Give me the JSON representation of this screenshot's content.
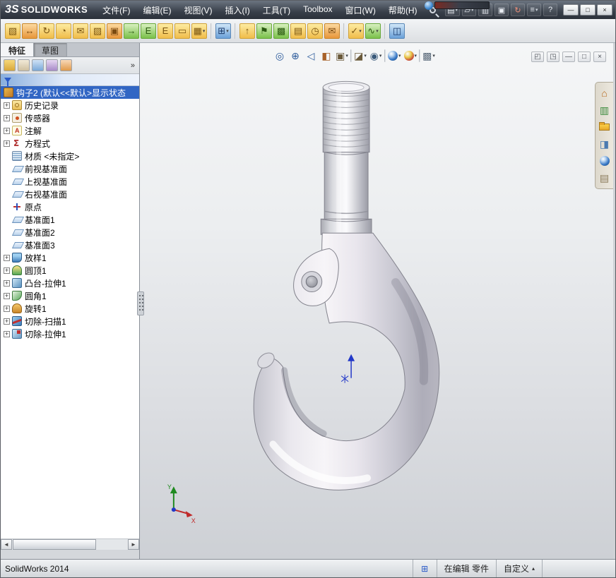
{
  "ui": {
    "dropdown_arrow": "▾",
    "plus": "+",
    "arrow_left": "◄",
    "arrow_right": "►",
    "up_arrow": "▴"
  },
  "titlebar": {
    "logo_mark": "3S",
    "brand": "SOLIDWORKS",
    "menus": [
      {
        "name": "menu-file",
        "label": "文件(F)"
      },
      {
        "name": "menu-edit",
        "label": "编辑(E)"
      },
      {
        "name": "menu-view",
        "label": "视图(V)"
      },
      {
        "name": "menu-insert",
        "label": "插入(I)"
      },
      {
        "name": "menu-tools",
        "label": "工具(T)"
      },
      {
        "name": "menu-toolbox",
        "label": "Toolbox"
      },
      {
        "name": "menu-window",
        "label": "窗口(W)"
      },
      {
        "name": "menu-help",
        "label": "帮助(H)"
      }
    ],
    "quick_icons": [
      {
        "name": "new-document-icon",
        "glyph": "▤",
        "arrow": true
      },
      {
        "name": "open-document-icon",
        "glyph": "▱",
        "arrow": true
      },
      {
        "name": "save-icon",
        "glyph": "▥"
      },
      {
        "name": "print-icon",
        "glyph": "▣"
      },
      {
        "name": "rebuild-icon",
        "glyph": "↻",
        "color": "#f0907a"
      },
      {
        "name": "options-icon",
        "glyph": "≡",
        "arrow": true
      },
      {
        "name": "help-icon",
        "glyph": "?"
      }
    ],
    "window_buttons": [
      {
        "name": "minimize-button",
        "glyph": "—"
      },
      {
        "name": "maximize-button",
        "glyph": "□"
      },
      {
        "name": "close-button",
        "glyph": "×"
      }
    ]
  },
  "toolbar": {
    "icons": [
      {
        "name": "color-palette-icon",
        "glyph": "▧",
        "cls": "t-yellow"
      },
      {
        "name": "move-component-icon",
        "glyph": "↔",
        "cls": "t-orange"
      },
      {
        "name": "rotate-component-icon",
        "glyph": "↻",
        "cls": "t-yellow"
      },
      {
        "name": "alert-icon",
        "glyph": "◔",
        "cls": "t-yellow"
      },
      {
        "name": "envelope-icon",
        "glyph": "✉",
        "cls": "t-yellow"
      },
      {
        "name": "edit-sketch-icon",
        "glyph": "▨",
        "cls": "t-yellow"
      },
      {
        "name": "stamp-icon",
        "glyph": "▣",
        "cls": "t-orange"
      },
      {
        "name": "export-arrow-icon",
        "glyph": "→",
        "cls": "t-green"
      },
      {
        "name": "edrawings-icon",
        "glyph": "E",
        "cls": "t-green"
      },
      {
        "name": "equation-icon",
        "glyph": "E",
        "cls": "t-yellow"
      },
      {
        "name": "ruler-icon",
        "glyph": "▭",
        "cls": "t-yellow"
      },
      {
        "name": "swatch-grid-icon",
        "glyph": "▦",
        "cls": "t-yellow",
        "arrow": true
      },
      {
        "cls": "sep"
      },
      {
        "name": "dot-grid-icon",
        "glyph": "⊞",
        "cls": "t-blue",
        "arrow": true
      },
      {
        "cls": "sep"
      },
      {
        "name": "publish-up-icon",
        "glyph": "↑",
        "cls": "t-yellow"
      },
      {
        "name": "flag-icon",
        "glyph": "⚑",
        "cls": "t-green"
      },
      {
        "name": "library-box-icon",
        "glyph": "▩",
        "cls": "t-green"
      },
      {
        "name": "folder-box-icon",
        "glyph": "▤",
        "cls": "t-yellow"
      },
      {
        "name": "clock-icon",
        "glyph": "◷",
        "cls": "t-yellow"
      },
      {
        "name": "mail-send-icon",
        "glyph": "✉",
        "cls": "t-orange"
      },
      {
        "cls": "sep"
      },
      {
        "name": "check-dropdown-icon",
        "glyph": "✓",
        "cls": "t-yellow",
        "arrow": true
      },
      {
        "name": "spring-icon",
        "glyph": "∿",
        "cls": "t-green",
        "arrow": true
      },
      {
        "cls": "sep"
      },
      {
        "name": "measure-toggle-icon",
        "glyph": "◫",
        "cls": "t-blue",
        "state": "active"
      }
    ]
  },
  "left_panel": {
    "tabs": [
      {
        "name": "tab-features",
        "label": "特征",
        "state": "active"
      },
      {
        "name": "tab-sketch",
        "label": "草图",
        "state": "inactive"
      }
    ],
    "pane_tabs": [
      {
        "name": "featuremanager-tab-icon",
        "cls": "pt-gold"
      },
      {
        "name": "propertymanager-tab-icon",
        "cls": "pt-beige"
      },
      {
        "name": "configurationmanager-tab-icon",
        "cls": "pt-blue"
      },
      {
        "name": "dimxpertmanager-tab-icon",
        "cls": "pt-violet"
      },
      {
        "name": "displaymanager-tab-icon",
        "cls": "pt-orange"
      }
    ],
    "overflow_chevron": "»",
    "tree": {
      "items": [
        {
          "name": "tree-item-part",
          "label": "钩子2 (默认<<默认>显示状态",
          "icon": "i-part",
          "state": "selected root"
        },
        {
          "name": "tree-item-history",
          "label": "历史记录",
          "icon": "i-history",
          "expand": true
        },
        {
          "name": "tree-item-sensors",
          "label": "传感器",
          "icon": "i-sensor",
          "expand": true
        },
        {
          "name": "tree-item-annotations",
          "label": "注解",
          "icon": "i-note",
          "expand": true
        },
        {
          "name": "tree-item-equations",
          "label": "方程式",
          "icon": "i-eq",
          "expand": true
        },
        {
          "name": "tree-item-material",
          "label": "材质 <未指定>",
          "icon": "i-mat"
        },
        {
          "name": "tree-item-front-plane",
          "label": "前视基准面",
          "icon": "i-plane"
        },
        {
          "name": "tree-item-top-plane",
          "label": "上视基准面",
          "icon": "i-plane"
        },
        {
          "name": "tree-item-right-plane",
          "label": "右视基准面",
          "icon": "i-plane"
        },
        {
          "name": "tree-item-origin",
          "label": "原点",
          "icon": "i-origin"
        },
        {
          "name": "tree-item-plane1",
          "label": "基准面1",
          "icon": "i-plane"
        },
        {
          "name": "tree-item-plane2",
          "label": "基准面2",
          "icon": "i-plane"
        },
        {
          "name": "tree-item-plane3",
          "label": "基准面3",
          "icon": "i-plane"
        },
        {
          "name": "tree-item-loft1",
          "label": "放样1",
          "icon": "i-loft",
          "expand": true
        },
        {
          "name": "tree-item-dome1",
          "label": "圆顶1",
          "icon": "i-dome",
          "expand": true
        },
        {
          "name": "tree-item-boss-extrude1",
          "label": "凸台-拉伸1",
          "icon": "i-boss",
          "expand": true
        },
        {
          "name": "tree-item-fillet1",
          "label": "圆角1",
          "icon": "i-fillet",
          "expand": true
        },
        {
          "name": "tree-item-revolve1",
          "label": "旋转1",
          "icon": "i-revolve",
          "expand": true
        },
        {
          "name": "tree-item-cut-sweep1",
          "label": "切除-扫描1",
          "icon": "i-sweepcut",
          "expand": true
        },
        {
          "name": "tree-item-cut-extrude1",
          "label": "切除-拉伸1",
          "icon": "i-cutextrude",
          "expand": true
        }
      ]
    }
  },
  "viewport": {
    "headsup": [
      {
        "name": "zoom-fit-icon",
        "glyph": "◎",
        "color": "#2a5a9a"
      },
      {
        "name": "zoom-area-icon",
        "glyph": "⊕",
        "color": "#2a5a9a"
      },
      {
        "name": "previous-view-icon",
        "glyph": "◁",
        "color": "#2a5a9a"
      },
      {
        "name": "section-view-icon",
        "glyph": "◧",
        "color": "#a8622a"
      },
      {
        "name": "view-orientation-icon",
        "glyph": "▣",
        "color": "#6a5a3a",
        "arrow": true
      },
      {
        "cls": "sep"
      },
      {
        "name": "display-style-icon",
        "glyph": "◪",
        "color": "#6a5a3a",
        "arrow": true
      },
      {
        "name": "hide-show-icon",
        "glyph": "◉",
        "color": "#3a5a7a",
        "arrow": true
      },
      {
        "cls": "sep"
      },
      {
        "name": "appearances-icon",
        "sphere": "sphere",
        "arrow": true
      },
      {
        "name": "scene-icon",
        "sphere": "sphere2",
        "arrow": true
      },
      {
        "cls": "sep"
      },
      {
        "name": "view-settings-icon",
        "glyph": "▩",
        "color": "#5a6a7a",
        "arrow": true
      }
    ],
    "doc_controls": [
      {
        "name": "pane-split-icon",
        "glyph": "◰"
      },
      {
        "name": "pane-full-icon",
        "glyph": "◳"
      },
      {
        "name": "doc-minimize-button",
        "glyph": "—"
      },
      {
        "name": "doc-restore-button",
        "glyph": "□"
      },
      {
        "name": "doc-close-button",
        "glyph": "×"
      }
    ],
    "task_pane": [
      {
        "name": "home-icon",
        "glyph": "⌂",
        "color": "#b86a1e"
      },
      {
        "name": "design-library-icon",
        "glyph": "▥",
        "color": "#3a8a3a"
      },
      {
        "name": "file-explorer-icon",
        "folder": "icn-folder"
      },
      {
        "name": "view-palette-icon",
        "glyph": "◨",
        "color": "#4a7ab0"
      },
      {
        "name": "appearances-scenes-icon",
        "sphere": "sphere"
      },
      {
        "name": "custom-properties-icon",
        "glyph": "▤",
        "color": "#8a7a5a"
      }
    ],
    "triad": {
      "x_label": "X",
      "y_label": "Y"
    }
  },
  "statusbar": {
    "app_version": "SolidWorks 2014",
    "icon_glyph": "⊞",
    "edit_state": "在编辑 零件",
    "customize": "自定义"
  }
}
